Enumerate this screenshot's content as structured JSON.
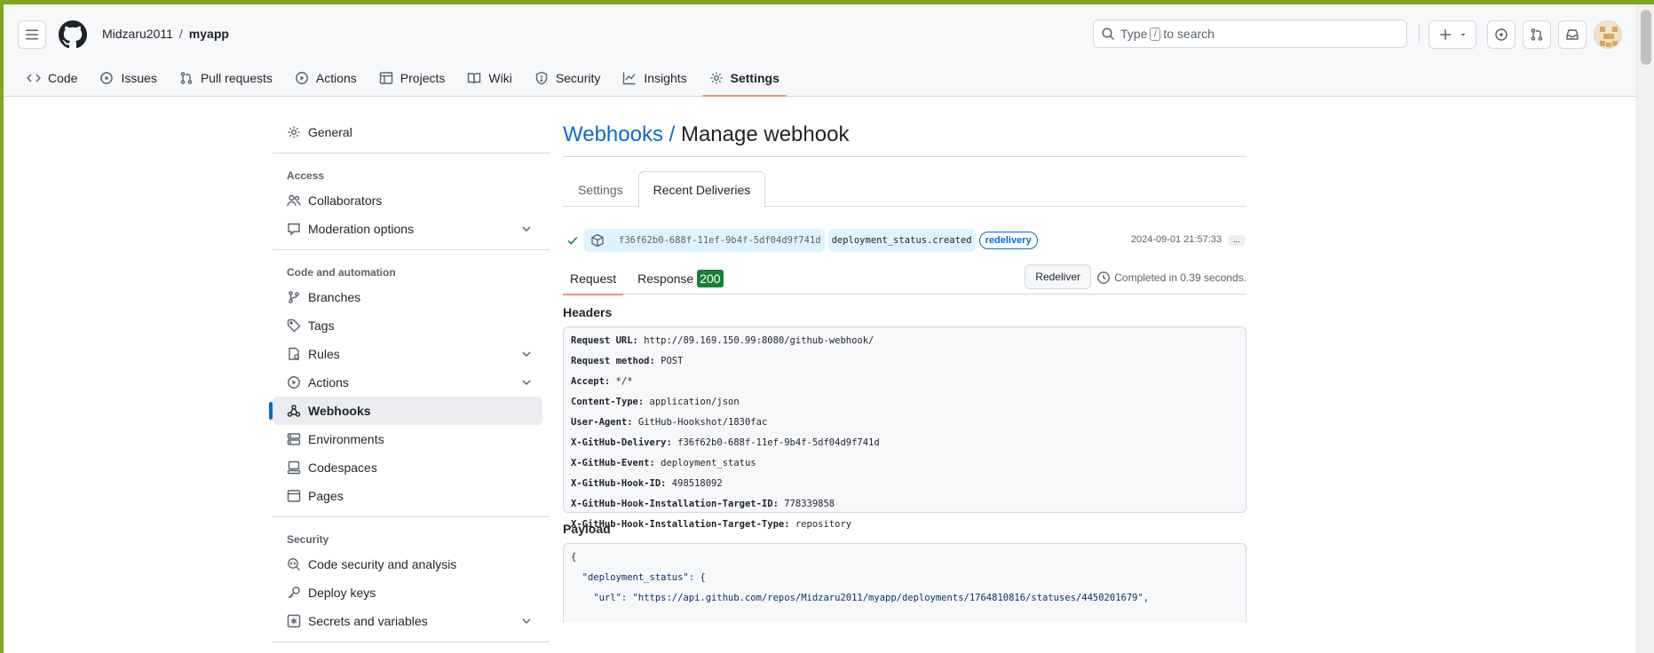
{
  "header": {
    "owner": "Midzaru2011",
    "separator": "/",
    "repo": "myapp",
    "search_prefix": "Type",
    "search_key": "/",
    "search_suffix": "to search"
  },
  "repo_nav": [
    {
      "label": "Code",
      "icon": "code-icon"
    },
    {
      "label": "Issues",
      "icon": "issue-icon"
    },
    {
      "label": "Pull requests",
      "icon": "pull-request-icon"
    },
    {
      "label": "Actions",
      "icon": "play-icon"
    },
    {
      "label": "Projects",
      "icon": "table-icon"
    },
    {
      "label": "Wiki",
      "icon": "book-icon"
    },
    {
      "label": "Security",
      "icon": "shield-icon"
    },
    {
      "label": "Insights",
      "icon": "graph-icon"
    },
    {
      "label": "Settings",
      "icon": "gear-icon",
      "active": true
    }
  ],
  "sidebar": {
    "general": "General",
    "access_group": "Access",
    "collaborators": "Collaborators",
    "moderation": "Moderation options",
    "code_group": "Code and automation",
    "branches": "Branches",
    "tags": "Tags",
    "rules": "Rules",
    "actions": "Actions",
    "webhooks": "Webhooks",
    "environments": "Environments",
    "codespaces": "Codespaces",
    "pages": "Pages",
    "security_group": "Security",
    "code_security": "Code security and analysis",
    "deploy_keys": "Deploy keys",
    "secrets": "Secrets and variables"
  },
  "main": {
    "breadcrumb": "Webhooks /",
    "title": "Manage webhook",
    "tabs": [
      "Settings",
      "Recent Deliveries"
    ],
    "delivery": {
      "guid": "f36f62b0-688f-11ef-9b4f-5df04d9f741d",
      "event": "deployment_status.created",
      "badge": "redelivery",
      "time": "2024-09-01 21:57:33",
      "more": "..."
    },
    "request_tab": "Request",
    "response_tab": "Response",
    "response_code": "200",
    "redeliver_label": "Redeliver",
    "completed": "Completed in 0.39 seconds.",
    "headers_title": "Headers",
    "headers": [
      {
        "k": "Request URL:",
        "v": "http://89.169.150.99:8080/github-webhook/"
      },
      {
        "k": "Request method:",
        "v": "POST"
      },
      {
        "k": "Accept:",
        "v": "*/*"
      },
      {
        "k": "Content-Type:",
        "v": "application/json"
      },
      {
        "k": "User-Agent:",
        "v": "GitHub-Hookshot/1830fac"
      },
      {
        "k": "X-GitHub-Delivery:",
        "v": "f36f62b0-688f-11ef-9b4f-5df04d9f741d"
      },
      {
        "k": "X-GitHub-Event:",
        "v": "deployment_status"
      },
      {
        "k": "X-GitHub-Hook-ID:",
        "v": "498518092"
      },
      {
        "k": "X-GitHub-Hook-Installation-Target-ID:",
        "v": "778339858"
      },
      {
        "k": "X-GitHub-Hook-Installation-Target-Type:",
        "v": "repository"
      }
    ],
    "payload_title": "Payload",
    "payload": {
      "line1": "{",
      "line2_key": "  \"deployment_status\": {",
      "line3_key": "    \"url\": ",
      "line3_val": "\"https://api.github.com/repos/Midzaru2011/myapp/deployments/1764810816/statuses/4450201679\","
    }
  }
}
